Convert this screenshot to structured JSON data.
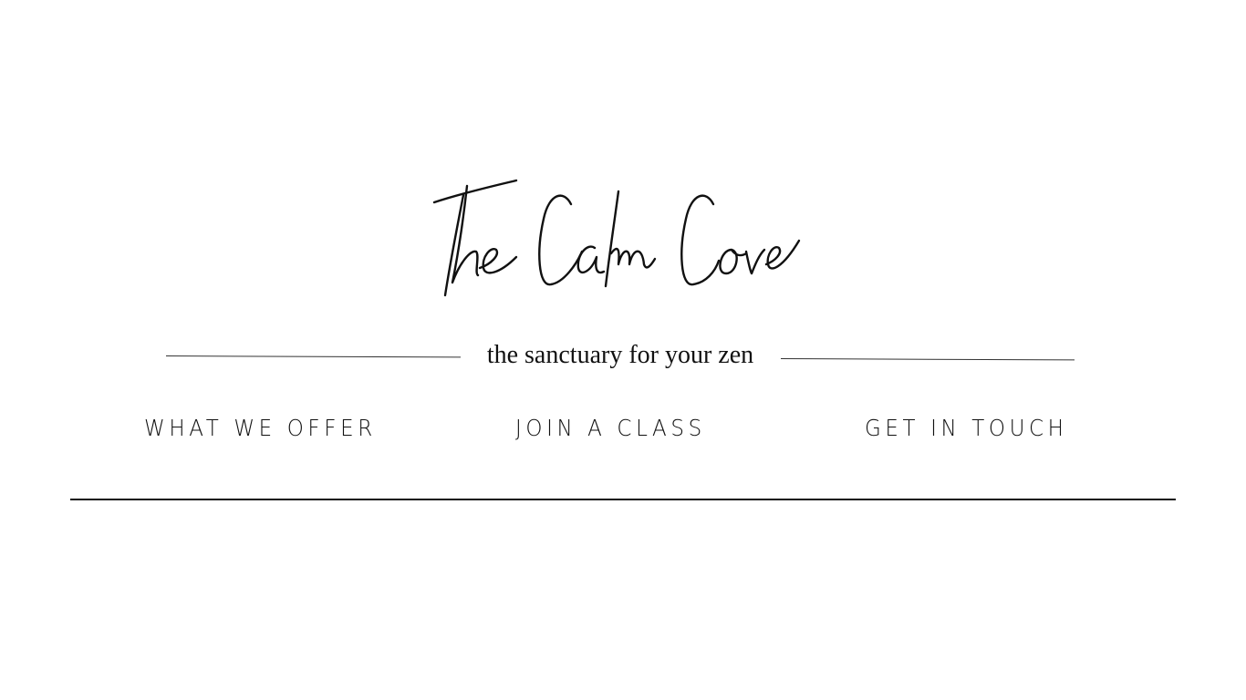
{
  "brand": {
    "name": "The Calm Cove",
    "tagline": "the sanctuary for your zen"
  },
  "nav": {
    "items": [
      {
        "label": "WHAT WE OFFER"
      },
      {
        "label": "JOIN A CLASS"
      },
      {
        "label": "GET IN TOUCH"
      }
    ]
  },
  "colors": {
    "text": "#111111",
    "background": "#ffffff"
  }
}
